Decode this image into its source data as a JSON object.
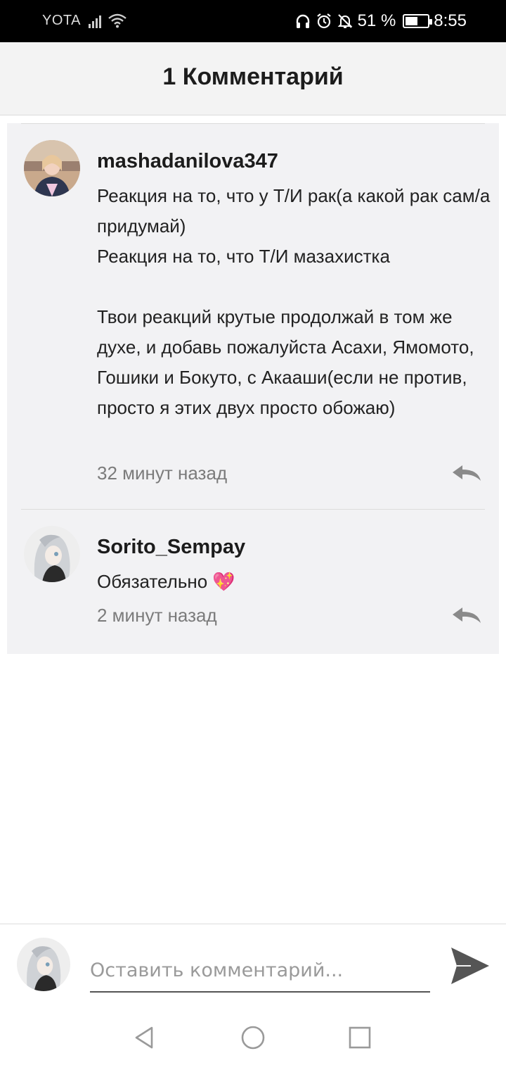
{
  "status_bar": {
    "carrier": "YOTA",
    "battery": "51 %",
    "time": "8:55",
    "icons": [
      "signal-icon",
      "wifi-icon",
      "headphones-icon",
      "alarm-icon",
      "mute-icon",
      "battery-icon"
    ]
  },
  "header": {
    "title": "1 Комментарий"
  },
  "comments": [
    {
      "username": "mashadanilova347",
      "text": "Реакция на то, что у Т/И рак(а какой рак сам/а придумай)\nРеакция на то, что Т/И мазахистка\n\nТвои реакций крутые продолжай в том же духе, и добавь пожалуйста Асахи, Ямомото,  Гошики и Бокуто,  с Акааши(если не против, просто я этих двух просто обожаю)",
      "time": "32 минут назад"
    },
    {
      "username": "Sorito_Sempay",
      "text": "Обязательно 💖",
      "time": "2 минут назад"
    }
  ],
  "composer": {
    "placeholder": "Оставить комментарий..."
  },
  "icons": {
    "reply": "reply-icon",
    "send": "send-icon",
    "nav": [
      "back-icon",
      "home-icon",
      "recents-icon"
    ]
  },
  "colors": {
    "panel": "#f2f2f4",
    "header": "#f3f3f3",
    "muted": "#7b7b7b",
    "icon": "#8a8a8a"
  }
}
